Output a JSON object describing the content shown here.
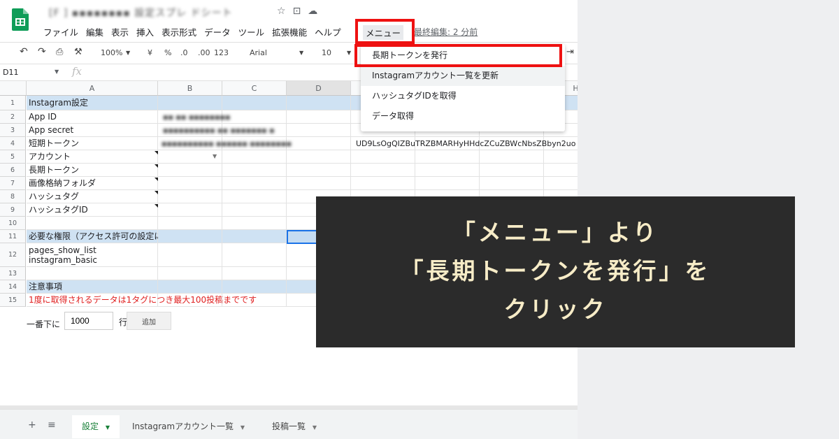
{
  "doc_title_blurred": "[F ] ▪▪▪▪▪▪▪▪ 設定スプレ ドシート",
  "menubar": [
    "ファイル",
    "編集",
    "表示",
    "挿入",
    "表示形式",
    "データ",
    "ツール",
    "拡張機能",
    "ヘルプ"
  ],
  "custom_menu": "メニュー",
  "last_edit": "最終編集: 2 分前",
  "toolbar": {
    "zoom": "100%",
    "currency": "¥",
    "percent": "%",
    "dec_less": ".0",
    "dec_more": ".00",
    "format_more": "123",
    "font": "Arial",
    "font_size": "10"
  },
  "namebox": "D11",
  "fx": "fx",
  "columns": [
    "A",
    "B",
    "C",
    "D",
    "E",
    "F",
    "G",
    "H"
  ],
  "rows": {
    "r1": "Instagram設定",
    "r2": "App ID",
    "r3": "App secret",
    "r4": "短期トークン",
    "r5": "アカウント",
    "r6": "長期トークン",
    "r7": "画像格納フォルダ",
    "r8": "ハッシュタグ",
    "r9": "ハッシュタグID",
    "r11": "必要な権限（アクセス許可の設定にて設定する必要のある権限）",
    "r12_line1": "pages_show_list",
    "r12_line2": "instagram_basic",
    "r14": "注意事項",
    "r15": "1度に取得されるデータは1タグにつき最大100投稿までです"
  },
  "row_numbers": [
    "1",
    "2",
    "3",
    "4",
    "5",
    "6",
    "7",
    "8",
    "9",
    "10",
    "11",
    "12",
    "13",
    "14",
    "15"
  ],
  "blurred": {
    "app_id": "▪▪ ▪▪ ▪▪▪▪▪▪▪▪",
    "app_secret": "▪▪▪▪▪▪▪▪▪▪ ▪▪ ▪▪▪▪▪▪▪ ▪",
    "token_prefix": "▪▪▪▪▪▪▪▪▪▪ ▪▪▪▪▪▪ ▪▪▪▪▪▪▪▪"
  },
  "short_token_visible": "UD9LsOgQIZBuTRZBMARHyHHdcZCuZBWcNbsZBbyn2uo",
  "dropdown_items": [
    "長期トークンを発行",
    "Instagramアカウント一覧を更新",
    "ハッシュタグIDを取得",
    "データ取得"
  ],
  "add_rows": {
    "label": "一番下に",
    "value": "1000",
    "unit": "行",
    "button": "追加"
  },
  "sheet_tabs": [
    "設定",
    "Instagramアカウント一覧",
    "投稿一覧"
  ],
  "overlay": {
    "line1": "「メニュー」より",
    "line2": "「長期トークンを発行」を",
    "line3": "クリック"
  },
  "colors": {
    "highlight_red": "#ee1111",
    "overlay_bg": "#2b2b2b",
    "overlay_text": "#f7ecc7",
    "section_blue": "#cfe2f3",
    "sheets_green": "#188038"
  }
}
